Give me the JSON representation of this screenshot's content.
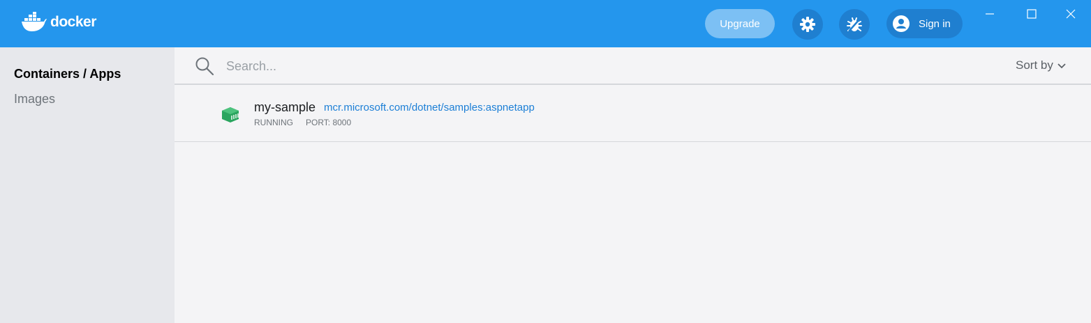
{
  "app": {
    "logo_text": "docker"
  },
  "header": {
    "upgrade_label": "Upgrade",
    "signin_label": "Sign in"
  },
  "sidebar": {
    "items": [
      {
        "label": "Containers / Apps",
        "active": true
      },
      {
        "label": "Images",
        "active": false
      }
    ]
  },
  "search": {
    "placeholder": "Search...",
    "value": ""
  },
  "sort": {
    "label": "Sort by"
  },
  "containers": [
    {
      "name": "my-sample",
      "image": "mcr.microsoft.com/dotnet/samples:aspnetapp",
      "status": "RUNNING",
      "port": "PORT: 8000"
    }
  ],
  "colors": {
    "header_bg": "#2496ed",
    "accent_link": "#1c7fd6",
    "running_icon": "#2aa55f"
  }
}
